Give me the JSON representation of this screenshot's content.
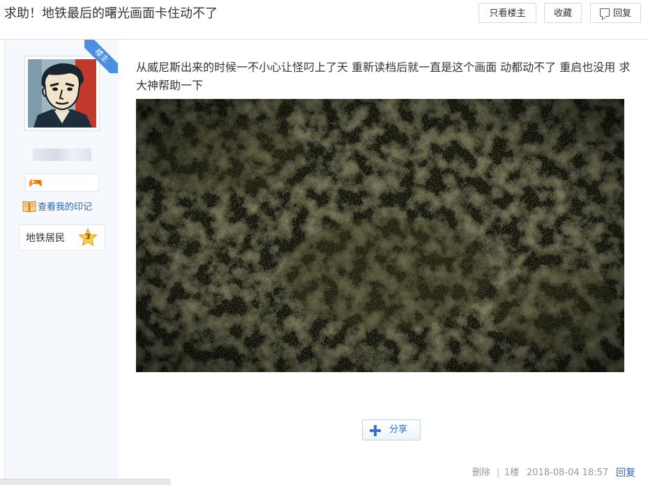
{
  "header": {
    "title": "求助！地铁最后的曙光画面卡住动不了",
    "only_op_label": "只看楼主",
    "favorite_label": "收藏",
    "reply_label": "回复"
  },
  "author": {
    "username": "",
    "op_badge": "楼主",
    "imprint_link": "查看我的印记",
    "level_title": "地铁居民",
    "level_number": "3"
  },
  "post": {
    "text": "从威尼斯出来的时候一不小心让怪叼上了天 重新读档后就一直是这个画面 动都动不了 重启也没用 求大神帮助一下",
    "share_label": "分享"
  },
  "footer": {
    "delete_label": "删除",
    "separator": "|",
    "floor": "1楼",
    "timestamp": "2018-08-04 18:57",
    "reply_label": "回复"
  },
  "colors": {
    "link": "#2d64b3",
    "sidebar_bg": "#f5f8fd",
    "op_badge": "#4a8fe0"
  },
  "icons": {
    "reply": "comment-icon",
    "imprint": "book-icon",
    "level": "star-icon",
    "share": "plus-icon",
    "medal": "game-controller-icon"
  }
}
